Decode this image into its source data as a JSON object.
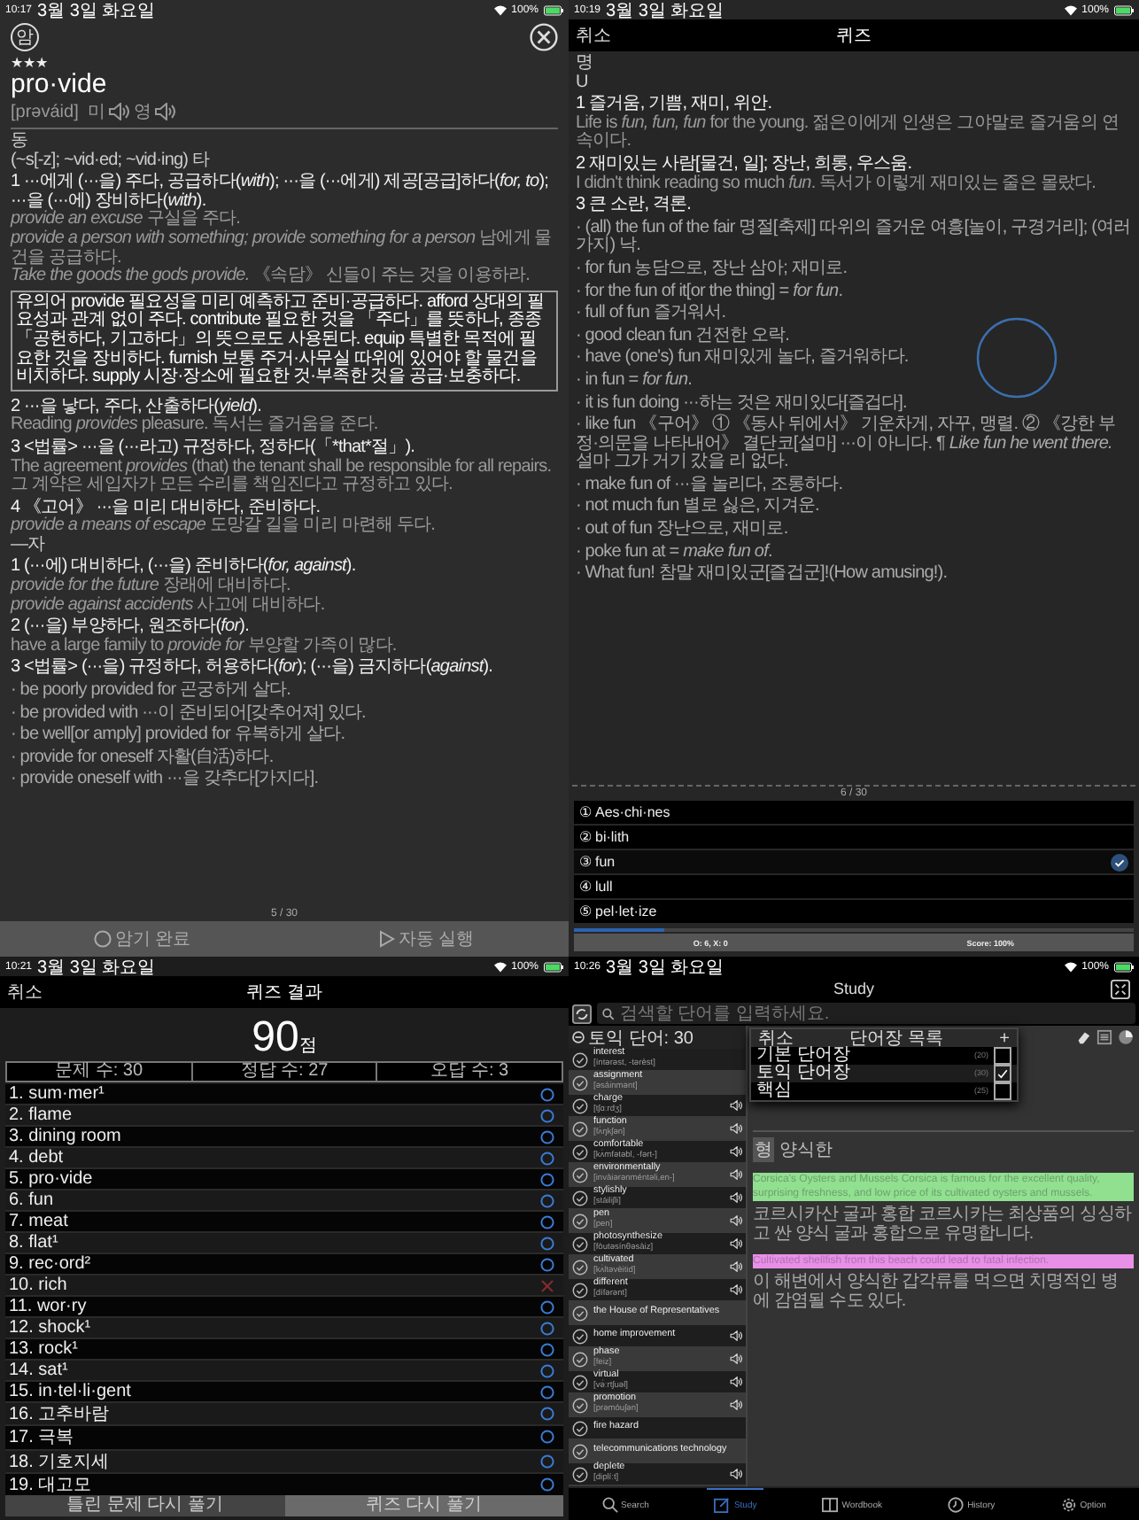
{
  "word_card": {
    "status": {
      "time": "10:17",
      "date": "3월 3일 화요일",
      "battery": "100%"
    },
    "memo_badge": "암",
    "stars": 3,
    "word": "pro·vide",
    "pronunciation": "[prəváid]",
    "audio": [
      "미",
      "영"
    ],
    "entries": [
      {
        "kind": "pos",
        "text": "동"
      },
      {
        "kind": "pos",
        "text": "(~s[-z]; ~vid·ed; ~vid·ing) 타"
      },
      {
        "kind": "head",
        "text": "1 ···에게 (···을) 주다, 공급하다(*with*); ···을 (···에게) 제공[공급]하다(*for, to*); ···을 (···에) 장비하다(*with*)."
      },
      {
        "kind": "example",
        "text": "*provide an excuse* 구실을 주다."
      },
      {
        "kind": "example",
        "text": "*provide a person with something; provide something for a person* 남에게 물건을 공급하다."
      },
      {
        "kind": "example",
        "text": "*Take the goods the gods provide.* 《속담》 신들이 주는 것을 이용하라."
      },
      {
        "kind": "note",
        "text": "유의어 provide 필요성을 미리 예측하고 준비·공급하다. afford 상대의 필요성과 관계 없이 주다. contribute 필요한 것을 「주다」를 뜻하나, 종종 「공헌하다, 기고하다」의 뜻으로도 사용된다. equip 특별한 목적에 필요한 것을 장비하다. furnish 보통 주거·사무실 따위에 있어야 할 물건을 비치하다. supply 시장·장소에 필요한 것·부족한 것을 공급·보충하다."
      },
      {
        "kind": "head",
        "text": "2 ···을 낳다, 주다, 산출하다(*yield*)."
      },
      {
        "kind": "example",
        "text": "Reading *provides* pleasure. 독서는 즐거움을 준다."
      },
      {
        "kind": "head",
        "text": "3 <법률> ···을 (···라고) 규정하다, 정하다(「*that*절」)."
      },
      {
        "kind": "example",
        "text": "The agreement *provides* (that) the tenant shall be responsible for all repairs. 그 계약은 세입자가 모든 수리를 책임진다고 규정하고 있다."
      },
      {
        "kind": "head",
        "text": "4 《고어》 ···을 미리 대비하다, 준비하다."
      },
      {
        "kind": "example",
        "text": "*provide a means of escape* 도망갈 길을 미리 마련해 두다."
      },
      {
        "kind": "pos",
        "text": "—자"
      },
      {
        "kind": "head",
        "text": "1 (···에) 대비하다, (···을) 준비하다(*for, against*)."
      },
      {
        "kind": "example",
        "text": "*provide for the future* 장래에 대비하다."
      },
      {
        "kind": "example",
        "text": "*provide against accidents* 사고에 대비하다."
      },
      {
        "kind": "head",
        "text": "2 (···을) 부양하다, 원조하다(*for*)."
      },
      {
        "kind": "example",
        "text": "have a large family to *provide for* 부양할 가족이 많다."
      },
      {
        "kind": "head",
        "text": "3 <법률> (···을) 규정하다, 허용하다(*for*); (···을) 금지하다(*against*)."
      },
      {
        "kind": "phrase",
        "text": "· be poorly provided for 곤궁하게 살다."
      },
      {
        "kind": "phrase",
        "text": "· be provided with ···이 준비되어[갖추어져] 있다."
      },
      {
        "kind": "phrase",
        "text": "· be well[or amply] provided for 유복하게 살다."
      },
      {
        "kind": "phrase",
        "text": "· provide for oneself 자활(自活)하다."
      },
      {
        "kind": "phrase",
        "text": "· provide oneself with ···을 갖추다[가지다]."
      }
    ],
    "page": "5 / 30",
    "actions": [
      {
        "label": "암기 완료"
      },
      {
        "label": "자동 실행"
      }
    ]
  },
  "quiz": {
    "status": {
      "time": "10:19",
      "date": "3월 3일 화요일",
      "battery": "100%"
    },
    "cancel": "취소",
    "title": "퀴즈",
    "entries": [
      {
        "kind": "pos",
        "text": "명"
      },
      {
        "kind": "pos",
        "text": "U"
      },
      {
        "kind": "head",
        "text": "1 즐거움, 기쁨, 재미, 위안."
      },
      {
        "kind": "example",
        "text": "Life is *fun, fun, fun* for the young. 젊은이에게 인생은 그야말로 즐거움의 연속이다."
      },
      {
        "kind": "head",
        "text": "2 재미있는 사람[물건, 일]; 장난, 희롱, 우스움."
      },
      {
        "kind": "example",
        "text": "I didn't think reading so much *fun*. 독서가 이렇게 재미있는 줄은 몰랐다."
      },
      {
        "kind": "head",
        "text": "3 큰 소란, 격론."
      },
      {
        "kind": "phrase",
        "text": "· (all) the fun of the fair 명절[축제] 따위의 즐거운 여흥[놀이, 구경거리]; (여러 가지) 낙."
      },
      {
        "kind": "phrase",
        "text": "· for fun 농담으로, 장난 삼아; 재미로."
      },
      {
        "kind": "phrase",
        "text": "· for the fun of it[or the thing] = *for fun*."
      },
      {
        "kind": "phrase",
        "text": "· full of fun 즐거워서."
      },
      {
        "kind": "phrase",
        "text": "· good clean fun 건전한 오락."
      },
      {
        "kind": "phrase",
        "text": "· have (one's) fun 재미있게 놀다, 즐거워하다."
      },
      {
        "kind": "phrase",
        "text": "· in fun = *for fun*."
      },
      {
        "kind": "phrase",
        "text": "· it is fun doing ···하는 것은 재미있다[즐겁다]."
      },
      {
        "kind": "phrase",
        "text": "· like fun 《구어》 ① 《동사 뒤에서》 기운차게, 자꾸, 맹렬. ② 《강한 부정·의문을 나타내어》 결단코[설마] ···이 아니다. ¶ *Like fun he went there.* 설마 그가 거기 갔을 리 없다."
      },
      {
        "kind": "phrase",
        "text": "· make fun of ···을 놀리다, 조롱하다."
      },
      {
        "kind": "phrase",
        "text": "· not much fun 별로 싫은, 지겨운."
      },
      {
        "kind": "phrase",
        "text": "· out of fun 장난으로, 재미로."
      },
      {
        "kind": "phrase",
        "text": "· poke fun at = *make fun of*."
      },
      {
        "kind": "phrase",
        "text": "· What fun! 참말 재미있군[즐겁군]!(How amusing!)."
      }
    ],
    "page": "6 / 30",
    "choices": [
      {
        "number": "①",
        "text": "Aes·chi·nes",
        "selected": false
      },
      {
        "number": "②",
        "text": "bi·lith",
        "selected": false
      },
      {
        "number": "③",
        "text": "fun",
        "selected": true
      },
      {
        "number": "④",
        "text": "lull",
        "selected": false
      },
      {
        "number": "⑤",
        "text": "pel·let·ize",
        "selected": false
      }
    ],
    "progress": {
      "level": 0.16
    },
    "tally": "O: 6, X: 0",
    "score": "Score: 100%"
  },
  "quiz_result": {
    "status": {
      "time": "10:21",
      "date": "3월 3일 화요일",
      "battery": "100%"
    },
    "cancel": "취소",
    "title": "퀴즈 결과",
    "score": "90",
    "unit": "점",
    "stats": [
      "문제 수: 30",
      "정답 수: 27",
      "오답 수: 3"
    ],
    "rows": [
      {
        "label": "1. sum·mer¹",
        "correct": true
      },
      {
        "label": "2. flame",
        "correct": true
      },
      {
        "label": "3. dining room",
        "correct": true
      },
      {
        "label": "4. debt",
        "correct": true
      },
      {
        "label": "5. pro·vide",
        "correct": true
      },
      {
        "label": "6. fun",
        "correct": true
      },
      {
        "label": "7. meat",
        "correct": true
      },
      {
        "label": "8. flat¹",
        "correct": true
      },
      {
        "label": "9. rec·ord²",
        "correct": true
      },
      {
        "label": "10. rich",
        "correct": false
      },
      {
        "label": "11. wor·ry",
        "correct": true
      },
      {
        "label": "12. shock¹",
        "correct": true
      },
      {
        "label": "13. rock¹",
        "correct": true
      },
      {
        "label": "14. sat¹",
        "correct": true
      },
      {
        "label": "15. in·tel·li·gent",
        "correct": true
      },
      {
        "label": "16. 고추바람",
        "correct": true
      },
      {
        "label": "17. 극복",
        "correct": true
      },
      {
        "label": "18. 기호지세",
        "correct": true
      },
      {
        "label": "19. 대고모",
        "correct": true
      }
    ],
    "buttons": [
      "틀린 문제 다시 풀기",
      "퀴즈 다시 풀기"
    ]
  },
  "study": {
    "status": {
      "time": "10:26",
      "date": "3월 3일 화요일",
      "battery": "100%"
    },
    "title": "Study",
    "search": {
      "placeholder": "검색할 단어를 입력하세요."
    },
    "list_title": "토익 단어: 30",
    "words": [
      {
        "word": "interest",
        "pronunciation": "[íntərəst, -tərèst]"
      },
      {
        "word": "assignment",
        "pronunciation": "[əsáinmənt]"
      },
      {
        "word": "charge",
        "pronunciation": "[tʃɑːrdʒ]",
        "audio": true
      },
      {
        "word": "function",
        "pronunciation": "[fʌ́ŋkʃən]",
        "audio": true
      },
      {
        "word": "comfortable",
        "pronunciation": "[kʌ́mfətəbl, -fərt-]",
        "audio": true
      },
      {
        "word": "environmentally",
        "pronunciation": "[invàiərənméntəli,en-]",
        "audio": true
      },
      {
        "word": "stylishly",
        "pronunciation": "[stáiliʃli]",
        "audio": true
      },
      {
        "word": "pen",
        "pronunciation": "[pen]",
        "audio": true
      },
      {
        "word": "photosynthesize",
        "pronunciation": "[fòutəsínθəsàiz]",
        "audio": true
      },
      {
        "word": "cultivated",
        "pronunciation": "[kʌ́ltəvèitid]",
        "audio": true
      },
      {
        "word": "different",
        "pronunciation": "[dífərənt]",
        "audio": true
      },
      {
        "word": "the House of Representatives",
        "audio": false
      },
      {
        "word": "home improvement",
        "audio": true
      },
      {
        "word": "phase",
        "pronunciation": "[feiz]",
        "audio": true
      },
      {
        "word": "virtual",
        "pronunciation": "[və́ːrtʃuəl]",
        "audio": true
      },
      {
        "word": "promotion",
        "pronunciation": "[prəmóuʃən]",
        "audio": true
      },
      {
        "word": "fire hazard",
        "audio": false
      },
      {
        "word": "telecommunications technology",
        "audio": false
      },
      {
        "word": "deplete",
        "pronunciation": "[diplíːt]",
        "audio": true
      }
    ],
    "wordbook_popup": {
      "cancel": "취소",
      "title": "단어장 목록",
      "add": "+",
      "books": [
        {
          "name": "기본 단어장",
          "count": "(20)",
          "checked": false
        },
        {
          "name": "토익 단어장",
          "count": "(30)",
          "checked": true
        },
        {
          "name": "핵심",
          "count": "(25)",
          "checked": false
        }
      ]
    },
    "detail": {
      "part": "형",
      "meaning": "양식한",
      "sentences": [
        {
          "text": "Corsica's Oysters and Mussels Corsica is famous for the excellent quality, surprising freshness, and low price of its cultivated oysters and mussels.",
          "color": "#90e090",
          "translation": "코르시카산 굴과 홍합 코르시카는 최상품의 싱싱하고 싼 양식 굴과 홍합으로 유명합니다."
        },
        {
          "text": "Cultivated shellfish from this beach could lead to fatal infection.",
          "color": "#e890e8",
          "translation": "이 해변에서 양식한 갑각류를 먹으면 치명적인 병에 감염될 수도 있다."
        }
      ]
    },
    "tabs": [
      {
        "label": "Search",
        "selected": false
      },
      {
        "label": "Study",
        "selected": true
      },
      {
        "label": "Wordbook",
        "selected": false
      },
      {
        "label": "History",
        "selected": false
      },
      {
        "label": "Option",
        "selected": false
      }
    ]
  }
}
